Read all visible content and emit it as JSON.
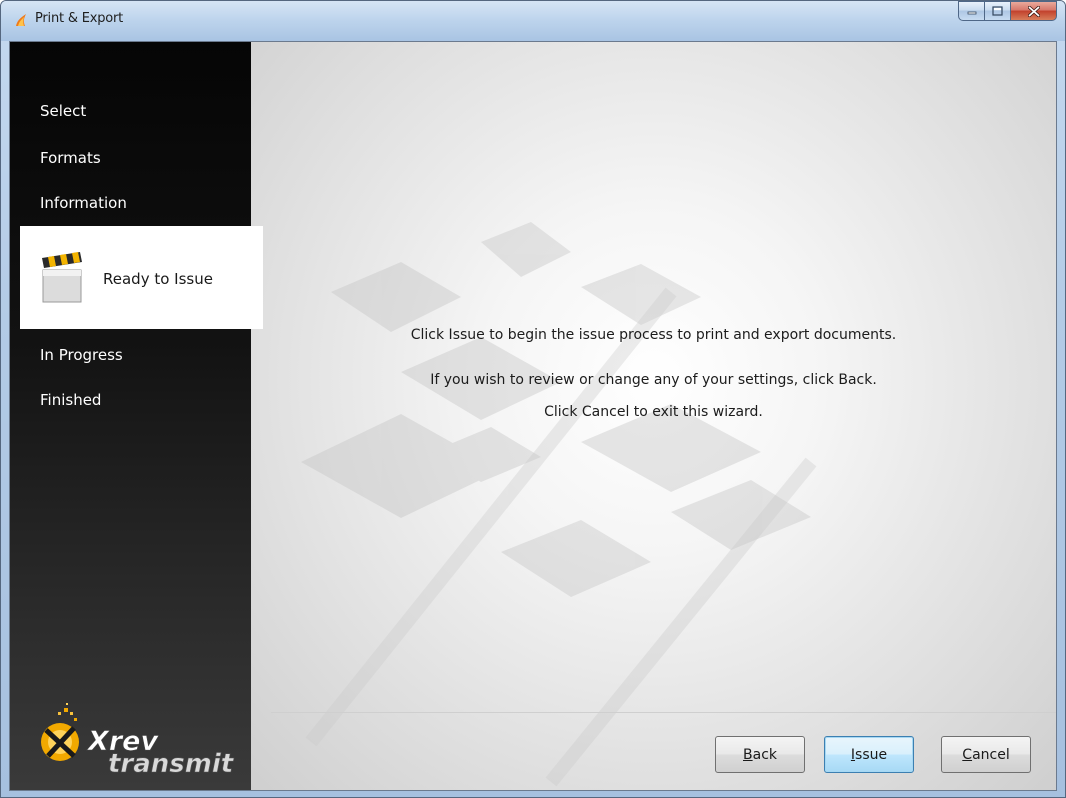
{
  "window": {
    "title": "Print & Export",
    "app_icon": "wizard-flame-icon",
    "caption_buttons": {
      "minimize": "minimize-icon",
      "maximize": "maximize-icon",
      "close": "close-icon"
    }
  },
  "sidebar": {
    "steps": [
      {
        "label": "Select",
        "active": false
      },
      {
        "label": "Formats",
        "active": false
      },
      {
        "label": "Information",
        "active": false
      },
      {
        "label": "Ready to Issue",
        "active": true,
        "icon": "clapperboard-icon"
      },
      {
        "label": "In Progress",
        "active": false
      },
      {
        "label": "Finished",
        "active": false
      }
    ],
    "logo": {
      "line1": "Xrev",
      "line2": "transmit"
    }
  },
  "main": {
    "messages": [
      "Click Issue to begin the issue process to print and export documents.",
      "If you wish to review or change any of your settings, click Back.",
      "Click Cancel to exit this wizard."
    ]
  },
  "buttons": {
    "back": {
      "mnemonic": "B",
      "rest": "ack"
    },
    "issue": {
      "mnemonic": "I",
      "rest": "ssue"
    },
    "cancel": {
      "mnemonic": "C",
      "rest": "ancel"
    }
  },
  "colors": {
    "sidebar_bg": "#0a0a0a",
    "active_step_bg": "#ffffff",
    "default_button": "#bee6fd",
    "close_button": "#c2412c",
    "logo_accent": "#f2a900"
  }
}
